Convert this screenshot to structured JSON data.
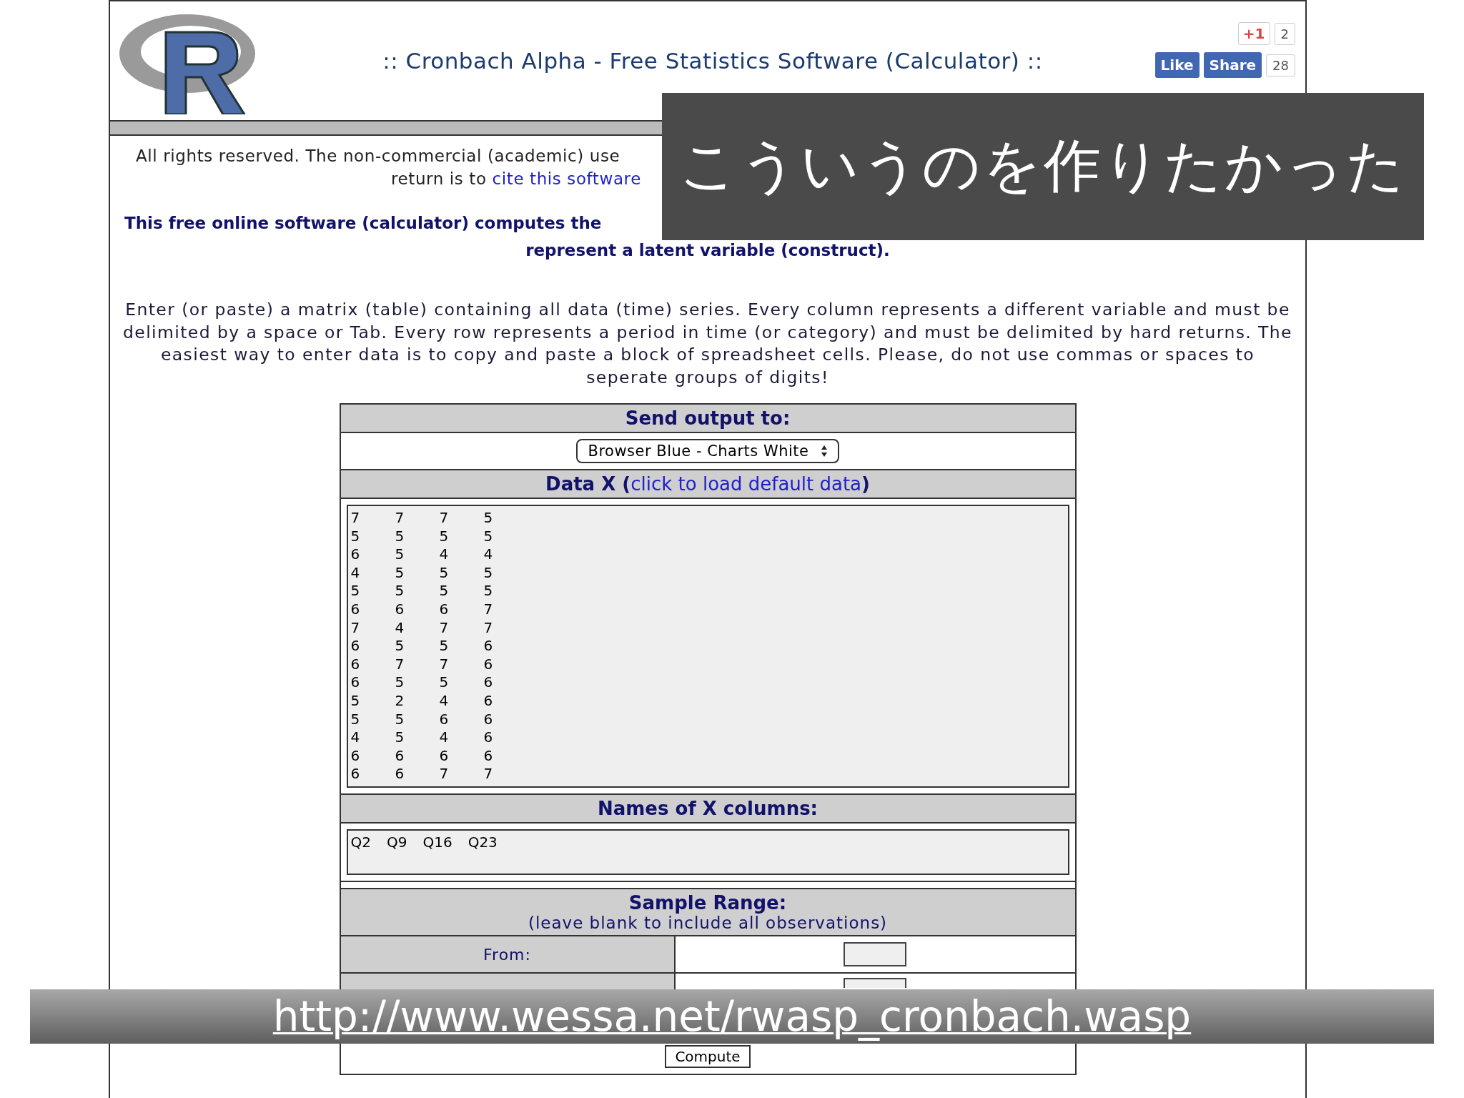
{
  "header": {
    "title": ":: Cronbach Alpha - Free Statistics Software (Calculator) ::",
    "social": {
      "plus_label": "+1",
      "plus_count": "2",
      "like_label": "Like",
      "share_label": "Share",
      "share_count": "28"
    }
  },
  "intro": {
    "line_1": "All rights reserved. The non-commercial (academic) use",
    "before_link": "return is to ",
    "link": "cite this software"
  },
  "summary": {
    "line_1": "This free online software (calculator) computes the",
    "line_2": "represent a latent variable (construct)."
  },
  "instructions": "Enter (or paste) a matrix (table) containing all data (time) series. Every column represents a different variable and must be delimited by a space or Tab. Every row represents a period in time (or category) and must be delimited by hard returns. The easiest way to enter data is to copy and paste a block of spreadsheet cells. Please, do not use commas or spaces to seperate groups of digits!",
  "form": {
    "output_heading": "Send output to:",
    "output_select": "Browser Blue - Charts White",
    "data_heading": "Data X (",
    "data_link": "click to load default data",
    "data_heading_end": ")",
    "data_rows": [
      [
        "7",
        "7",
        "7",
        "5"
      ],
      [
        "5",
        "5",
        "5",
        "5"
      ],
      [
        "6",
        "5",
        "4",
        "4"
      ],
      [
        "4",
        "5",
        "5",
        "5"
      ],
      [
        "5",
        "5",
        "5",
        "5"
      ],
      [
        "6",
        "6",
        "6",
        "7"
      ],
      [
        "7",
        "4",
        "7",
        "7"
      ],
      [
        "6",
        "5",
        "5",
        "6"
      ],
      [
        "6",
        "7",
        "7",
        "6"
      ],
      [
        "6",
        "5",
        "5",
        "6"
      ],
      [
        "5",
        "2",
        "4",
        "6"
      ],
      [
        "5",
        "5",
        "6",
        "6"
      ],
      [
        "4",
        "5",
        "4",
        "6"
      ],
      [
        "6",
        "6",
        "6",
        "6"
      ],
      [
        "6",
        "6",
        "7",
        "7"
      ]
    ],
    "names_heading": "Names of X columns:",
    "names": [
      "Q2",
      "Q9",
      "Q16",
      "Q23"
    ],
    "range_heading": "Sample Range:",
    "range_hint": "(leave blank to include all observations)",
    "from_label": "From:",
    "compute": "Compute"
  },
  "overlay_caption": "こういうのを作りたかった",
  "url_banner": "http://www.wessa.net/rwasp_cronbach.wasp"
}
